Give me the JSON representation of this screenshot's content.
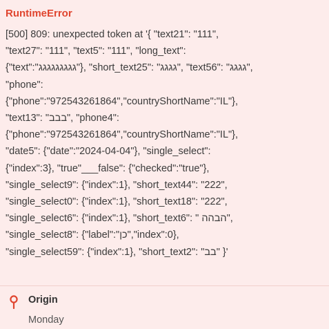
{
  "error": {
    "title": "RuntimeError",
    "message_lines": [
      "[500] 809: unexpected token at '{ \"text21\": \"111\",",
      "\"text27\": \"111\", \"text5\": \"111\", \"long_text\":",
      "{\"text\":\"גגגגגגגגג\"}, \"short_text25\": \"גגגג\", \"text56\": \"גגגג\",",
      "\"phone\":",
      "{\"phone\":\"972543261864\",\"countryShortName\":\"IL\"},",
      "\"text13\": \"בבב\", \"phone4\":",
      "{\"phone\":\"972543261864\",\"countryShortName\":\"IL\"},",
      "\"date5\": {\"date\":\"2024-04-04\"}, \"single_select\":",
      "{\"index\":3}, \"true\"___false\": {\"checked\":\"true\"},",
      "\"single_select9\": {\"index\":1}, \"short_text44\": \"222\",",
      "\"single_select0\": {\"index\":1}, \"short_text18\": \"222\",",
      "\"single_select6\": {\"index\":1}, \"short_text6\": \" הבהה\",",
      "\"single_select8\": {\"label\":\"כן\",\"index\":0},",
      "\"single_select59\": {\"index\":1}, \"short_text2\": \"בב\" }'"
    ]
  },
  "origin": {
    "icon": "location-pin-icon",
    "label": "Origin",
    "value": "Monday"
  },
  "colors": {
    "background": "#fdeceb",
    "error_title": "#e0452f",
    "pin": "#e0452f"
  }
}
